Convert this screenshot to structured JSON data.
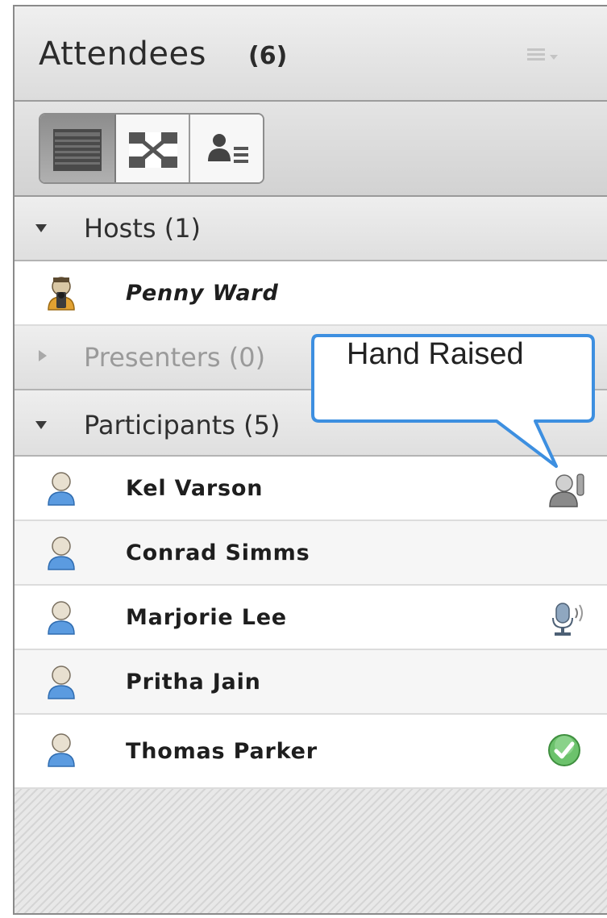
{
  "panel": {
    "title": "Attendees",
    "count": "(6)"
  },
  "view_buttons": [
    {
      "name": "list-view"
    },
    {
      "name": "fullscreen-view"
    },
    {
      "name": "detail-view"
    }
  ],
  "sections": {
    "hosts": {
      "label": "Hosts (1)",
      "expanded": true
    },
    "presenters": {
      "label": "Presenters (0)",
      "expanded": false
    },
    "participants": {
      "label": "Participants (5)",
      "expanded": true
    }
  },
  "hosts": [
    {
      "name": "Penny Ward",
      "icon": "host-icon"
    }
  ],
  "participants": [
    {
      "name": "Kel Varson",
      "status": "hand-raised-icon"
    },
    {
      "name": "Conrad Simms",
      "status": ""
    },
    {
      "name": "Marjorie Lee",
      "status": "microphone-icon"
    },
    {
      "name": "Pritha Jain",
      "status": ""
    },
    {
      "name": "Thomas Parker",
      "status": "agree-check-icon"
    }
  ],
  "tooltip": {
    "text": "Hand Raised"
  },
  "colors": {
    "callout_border": "#3d8fe0",
    "participant_icon": "#4a90d9",
    "host_icon": "#e0a030",
    "check_green": "#5cb85c"
  }
}
